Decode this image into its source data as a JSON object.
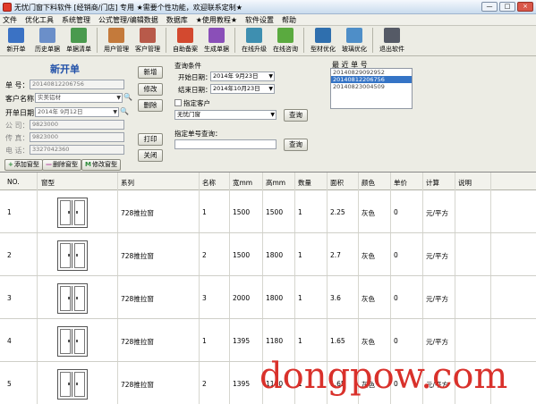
{
  "window": {
    "title": "无忧门窗下料软件 [经销商/门店]  专用     ★需要个性功能，欢迎联系定制★",
    "min": "—",
    "max": "□",
    "close": "×"
  },
  "menu": [
    "文件",
    "优化工具",
    "系统管理",
    "公式管理/编辑数据",
    "数据库",
    "★使用教程★",
    "软件设置",
    "帮助"
  ],
  "toolbar": [
    {
      "label": "新开单",
      "icon": "new-order-icon",
      "color": "#3b72c4"
    },
    {
      "label": "历史单据",
      "icon": "history-icon",
      "color": "#6b8fc9"
    },
    {
      "label": "单据清单",
      "icon": "list-icon",
      "color": "#4a9a4e"
    },
    {
      "label": "用户管理",
      "icon": "users-icon",
      "color": "#c47a3b"
    },
    {
      "label": "客户管理",
      "icon": "customers-icon",
      "color": "#b85a4a"
    },
    {
      "label": "自助备案",
      "icon": "archive-icon",
      "color": "#d3492f"
    },
    {
      "label": "生成单据",
      "icon": "generate-icon",
      "color": "#8a4fb8"
    },
    {
      "label": "在线升级",
      "icon": "upgrade-icon",
      "color": "#3e8fb0"
    },
    {
      "label": "在线咨询",
      "icon": "chat-icon",
      "color": "#5aaa3f"
    },
    {
      "label": "型材优化",
      "icon": "profile-opt-icon",
      "color": "#2f6fae"
    },
    {
      "label": "玻璃优化",
      "icon": "glass-opt-icon",
      "color": "#4e8ec8"
    },
    {
      "label": "退出软件",
      "icon": "exit-icon",
      "color": "#555a66"
    }
  ],
  "form": {
    "heading": "新开单",
    "order_no_label": "单 号：",
    "order_no": "20140812206756",
    "customer_label": "客户名称：",
    "customer": "实美铝材",
    "date_label": "开单日期：",
    "date": "2014年 9月12日",
    "company_label": "公 司：",
    "company": "9823000",
    "fax_label": "传 真：",
    "fax": "9823000",
    "phone_label": "电 话：",
    "phone": "3327042360"
  },
  "side_buttons": [
    "新增",
    "修改",
    "删除",
    "打印",
    "关闭"
  ],
  "bottom_buttons": [
    {
      "glyph": "+",
      "label": "添加窗型",
      "color": "#2e8b3a"
    },
    {
      "glyph": "—",
      "label": "删除窗型",
      "color": "#b03a9a"
    },
    {
      "glyph": "M",
      "label": "修改窗型",
      "color": "#2e8b3a"
    }
  ],
  "query": {
    "title": "查询条件",
    "start_label": "开始日期：",
    "start_date": "2014年 9月23日",
    "end_label": "结束日期：",
    "end_date": "2014年10月23日",
    "customer_check": "指定客户",
    "customer_select": "无忧门窗",
    "query_btn": "查询",
    "order_query_label": "指定单号查询：",
    "order_query_btn": "查询"
  },
  "recent": {
    "label": "最 近 单 号",
    "items": [
      "20140829092952",
      "20140812206756",
      "20140823004509"
    ]
  },
  "table": {
    "headers": [
      "NO.",
      "窗型",
      "系列",
      "名称",
      "宽mm",
      "高mm",
      "数量",
      "面积",
      "颜色",
      "单价",
      "计算",
      "说明"
    ],
    "rows": [
      [
        "1",
        "",
        "728推拉窗",
        "1",
        "1500",
        "1500",
        "1",
        "2.25",
        "灰色",
        "0",
        "元/平方",
        ""
      ],
      [
        "2",
        "",
        "728推拉窗",
        "2",
        "1500",
        "1800",
        "1",
        "2.7",
        "灰色",
        "0",
        "元/平方",
        ""
      ],
      [
        "3",
        "",
        "728推拉窗",
        "3",
        "2000",
        "1800",
        "1",
        "3.6",
        "灰色",
        "0",
        "元/平方",
        ""
      ],
      [
        "4",
        "",
        "728推拉窗",
        "1",
        "1395",
        "1180",
        "1",
        "1.65",
        "灰色",
        "0",
        "元/平方",
        ""
      ],
      [
        "5",
        "",
        "728推拉窗",
        "2",
        "1395",
        "1180",
        "1",
        "1.65",
        "灰色",
        "0",
        "元/平方",
        ""
      ]
    ]
  },
  "watermark": "dongpow.com"
}
